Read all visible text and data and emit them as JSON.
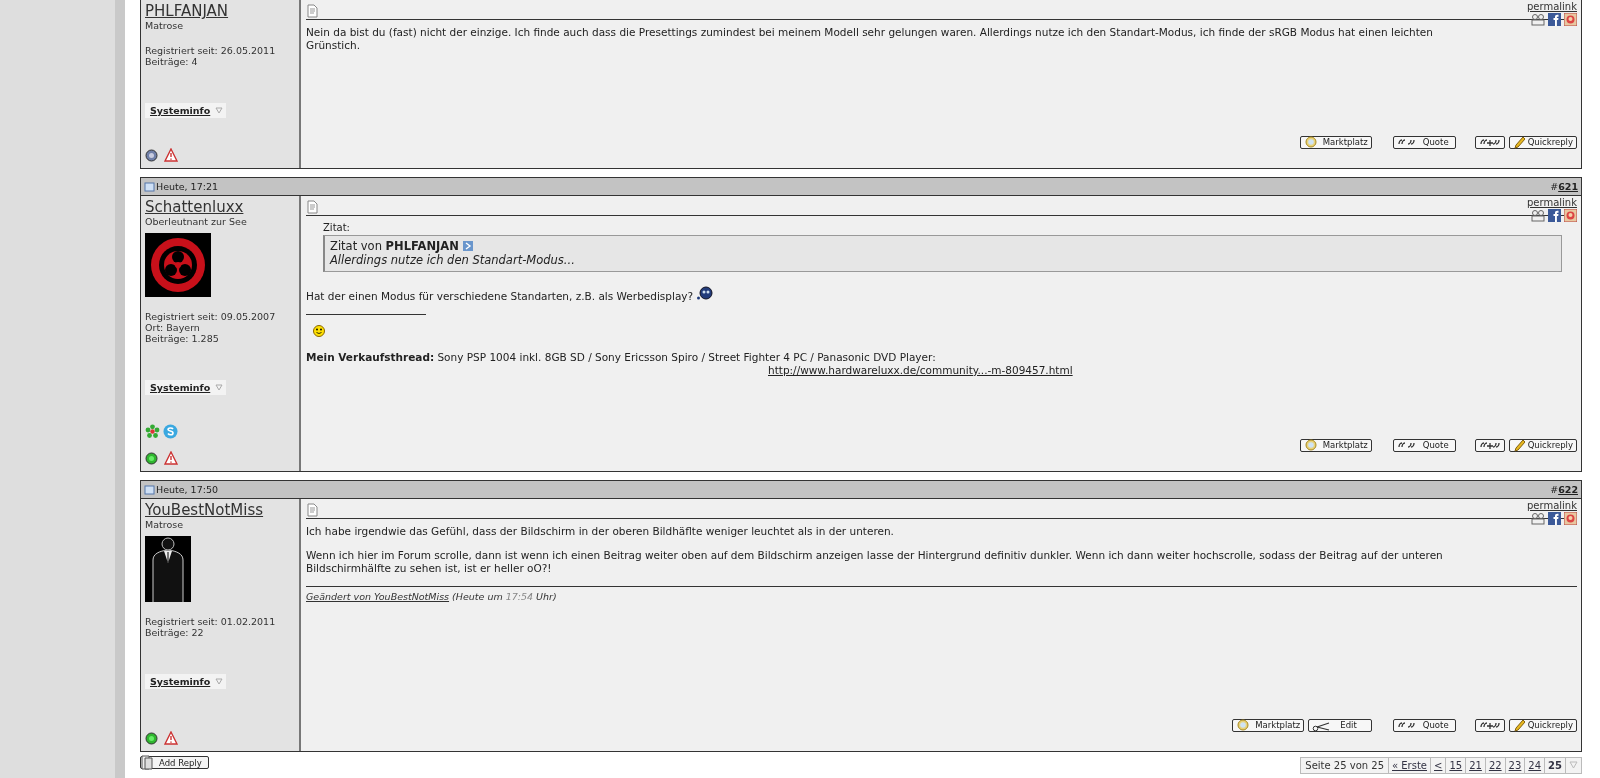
{
  "posts": [
    {
      "user": {
        "name": "PHLFANJAN",
        "rank": "Matrose",
        "info": [
          "Registriert seit: 26.05.2011",
          "Beiträge: 4"
        ],
        "systeminfo": "Systeminfo",
        "online": false
      },
      "permalink": "permalink",
      "paragraphs": [
        "Nein da bist du (fast) nicht der einzige. Ich finde auch dass die Presettings zumindest bei meinem Modell sehr gelungen waren. Allerdings nutze ich den Standart-Modus, ich finde der sRGB Modus hat einen leichten Grünstich."
      ],
      "buttons": [
        {
          "kind": "marktplatz",
          "label": "Marktplatz"
        },
        {
          "kind": "quote",
          "label": "Quote"
        },
        {
          "kind": "multiquote"
        },
        {
          "kind": "quickreply",
          "label": "Quickreply"
        }
      ]
    },
    {
      "header": {
        "date": "Heute, 17:21",
        "hash": "#",
        "number": "621"
      },
      "user": {
        "name": "Schattenluxx",
        "rank": "Oberleutnant zur See",
        "avatar": {
          "kind": "picture"
        },
        "info": [
          "Registriert seit: 09.05.2007",
          "Ort: Bayern",
          "Beiträge: 1.285"
        ],
        "systeminfo": "Systeminfo",
        "messengers": [
          {
            "kind": "icq"
          },
          {
            "kind": "skype"
          }
        ],
        "online": true
      },
      "permalink": "permalink",
      "quote": {
        "label": "Zitat:",
        "prefix": "Zitat von",
        "author": "PHLFANJAN",
        "text": "Allerdings nutze ich den Standart-Modus..."
      },
      "paragraphs": [
        "Hat der einen Modus für verschiedene Standarten, z.B. als Werbedisplay?"
      ],
      "emoticon": true,
      "signature": {
        "smiley": true,
        "text": "**Mein Verkaufsthread:** Sony PSP 1004 inkl. 8GB SD / Sony Ericsson Spiro / Street Fighter 4 PC / Panasonic DVD Player:",
        "link": "http://www.hardwareluxx.de/community...-m-809457.html"
      },
      "buttons": [
        {
          "kind": "marktplatz",
          "label": "Marktplatz"
        },
        {
          "kind": "quote",
          "label": "Quote"
        },
        {
          "kind": "multiquote"
        },
        {
          "kind": "quickreply",
          "label": "Quickreply"
        }
      ]
    },
    {
      "header": {
        "date": "Heute, 17:50",
        "hash": "#",
        "number": "622"
      },
      "user": {
        "name": "YouBestNotMiss",
        "rank": "Matrose",
        "avatar": {
          "kind": "picture"
        },
        "info": [
          "Registriert seit: 01.02.2011",
          "Beiträge: 22"
        ],
        "systeminfo": "Systeminfo",
        "online": true
      },
      "permalink": "permalink",
      "paragraphs": [
        "Ich habe irgendwie das Gefühl, dass der Bildschirm in der oberen Bildhäflte weniger leuchtet als in der unteren.",
        "Wenn ich hier im Forum scrolle, dann ist wenn ich einen Beitrag weiter oben auf dem Bildschirm anzeigen lasse der Hintergrund definitiv dunkler. Wenn ich dann weiter hochscrolle, sodass der Beitrag auf der unteren Bildschirmhälfte zu sehen ist, ist er heller oO?!"
      ],
      "edited": {
        "link": "Geändert von YouBestNotMiss",
        "prefix": "(Heute um",
        "time": "17:54",
        "suffix": "Uhr)"
      },
      "buttons": [
        {
          "kind": "marktplatz",
          "label": "Marktplatz"
        },
        {
          "kind": "edit",
          "label": "Edit"
        },
        {
          "kind": "quote",
          "label": "Quote"
        },
        {
          "kind": "multiquote"
        },
        {
          "kind": "quickreply",
          "label": "Quickreply"
        }
      ]
    }
  ],
  "footer": {
    "add_reply": "Add Reply",
    "pages": {
      "label": "Seite 25 von 25",
      "first": "« Erste",
      "prev": "<",
      "items": [
        {
          "label": "15",
          "selected": false
        },
        {
          "label": "21",
          "selected": false
        },
        {
          "label": "22",
          "selected": false
        },
        {
          "label": "23",
          "selected": false
        },
        {
          "label": "24",
          "selected": false
        },
        {
          "label": "25",
          "selected": true
        }
      ]
    }
  }
}
